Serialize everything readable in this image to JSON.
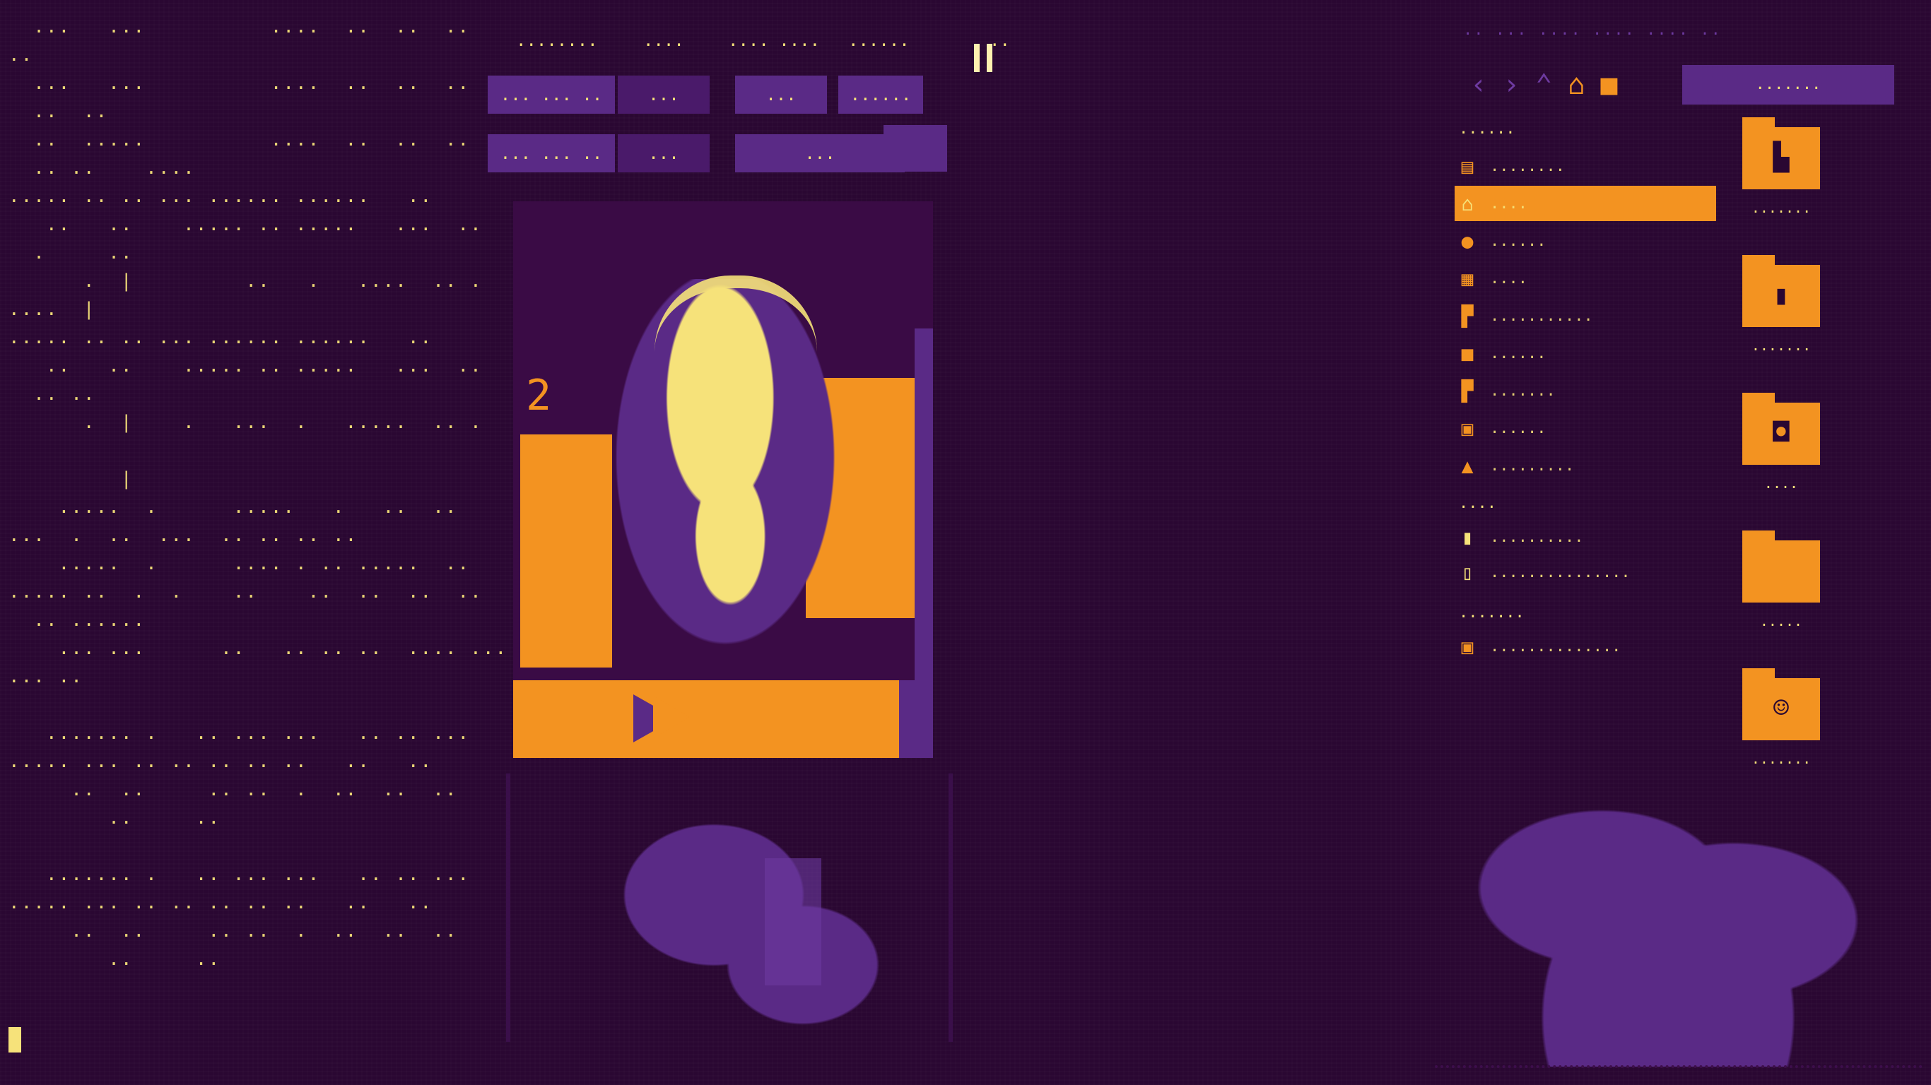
{
  "terminal": {
    "lines": [
      "  ...   ...          ....  ..  ..  ..",
      "..",
      "  ...   ...          ....  ..  ..  ..",
      "  ..  ..",
      "  ..  .....          ....  ..  ..  ..",
      "  .. ..    ....",
      "..... .. .. ... ...... ......   ..",
      "   ..   ..    ..... .. .....   ...  ..",
      "  .     ..",
      "      .  |         ..   .   ....  .. .",
      "....  |",
      "..... .. .. ... ...... ......   ..",
      "   ..   ..    ..... .. .....   ...  ..",
      "  .. ..",
      "      .  |    .   ...  .   .....  .. .",
      "",
      "         |",
      "    .....  .      .....   .   ..  ..",
      "...  .  ..  ...  .. .. .. ..",
      "    .....  .      .... . .. .....  ..",
      "..... ..  .  .    ..    ..  ..  ..  ..",
      "  .. ......",
      "    ... ...      ..   .. .. ..  .... ...",
      "... ..",
      "",
      "   ....... .   .. ... ...   .. .. ...",
      "..... ... .. .. .. .. ..   ..   ..",
      "     ..  ..     .. ..  .  ..  ..  ..",
      "        ..     ..",
      "",
      "   ....... .   .. ... ...   .. .. ...",
      "..... ... .. .. .. .. ..   ..   ..",
      "     ..  ..     .. ..  .  ..  ..  ..",
      "        ..     ..",
      "",
      ""
    ]
  },
  "topbar": {
    "items": [
      "........",
      "....",
      "....  ....",
      "......",
      "..  ..."
    ],
    "flag": ".."
  },
  "player": {
    "row1": [
      "... ...  ..",
      "...",
      "...",
      "......"
    ],
    "row2": [
      "... ...  ..",
      "...",
      "...",
      ""
    ]
  },
  "files": {
    "title": ".. ...  ....  ....  ....  ..",
    "nav": {
      "back": "‹",
      "forward": "›",
      "up": "⌃",
      "home": "⌂",
      "pin": "■"
    },
    "path": ".......",
    "sections": {
      "places": "......",
      "devices": "....",
      "network": "......."
    },
    "places": [
      {
        "icon": "▤",
        "label": "........"
      },
      {
        "icon": "⌂",
        "label": "....",
        "active": true
      },
      {
        "icon": "●",
        "label": "......"
      },
      {
        "icon": "▦",
        "label": "...."
      },
      {
        "icon": "▛",
        "label": "..........."
      },
      {
        "icon": "■",
        "label": "......"
      },
      {
        "icon": "▛",
        "label": "......."
      },
      {
        "icon": "▣",
        "label": "......"
      },
      {
        "icon": "▲",
        "label": "........."
      }
    ],
    "devices": [
      {
        "icon": "▮",
        "label": ".........."
      },
      {
        "icon": "▯",
        "label": "..............."
      }
    ],
    "network": [
      {
        "icon": "▣",
        "label": ".............."
      }
    ],
    "folders": [
      {
        "icon": "folder-documents-icon",
        "sym": "▙",
        "name": "......."
      },
      {
        "icon": "folder-downloads-icon",
        "sym": "▮",
        "name": "......."
      },
      {
        "icon": "folder-pictures-icon",
        "sym": "◘",
        "name": "...."
      },
      {
        "icon": "folder-plain-icon",
        "sym": "",
        "name": "....."
      },
      {
        "icon": "folder-public-icon",
        "sym": "☺",
        "name": "......."
      }
    ]
  },
  "colors": {
    "background": "#2a0732",
    "purple": "#5a2a86",
    "orange": "#f39321",
    "yellow": "#f6e27a"
  }
}
